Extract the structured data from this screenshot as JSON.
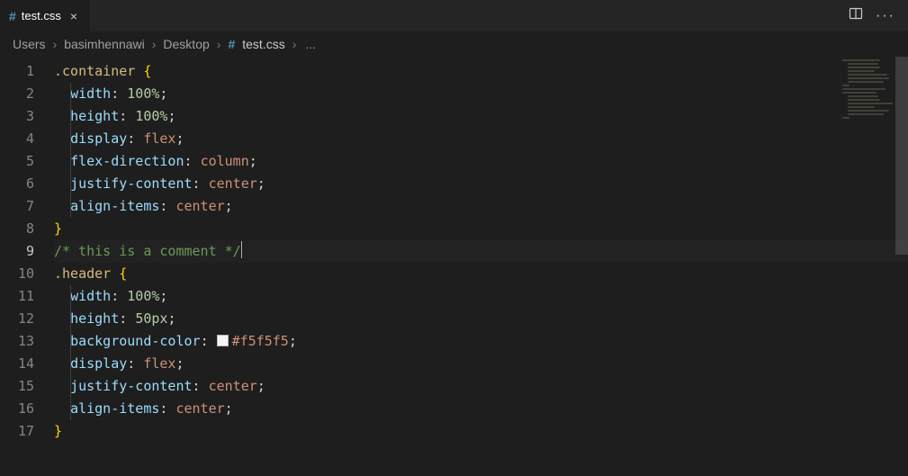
{
  "tab": {
    "icon": "#",
    "label": "test.css",
    "close": "×"
  },
  "title_actions": {
    "more": "···"
  },
  "breadcrumbs": {
    "parts": [
      "Users",
      "basimhennawi",
      "Desktop"
    ],
    "file_icon": "#",
    "filename": "test.css",
    "trailing": "..."
  },
  "active_line": 9,
  "code": {
    "lines": [
      {
        "n": 1,
        "indent": 0,
        "tokens": [
          {
            "t": ".container ",
            "c": "tok-sel"
          },
          {
            "t": "{",
            "c": "tok-brace"
          }
        ]
      },
      {
        "n": 2,
        "indent": 1,
        "tokens": [
          {
            "t": "width",
            "c": "tok-prop"
          },
          {
            "t": ": ",
            "c": "tok-punc"
          },
          {
            "t": "100%",
            "c": "tok-num"
          },
          {
            "t": ";",
            "c": "tok-punc"
          }
        ]
      },
      {
        "n": 3,
        "indent": 1,
        "tokens": [
          {
            "t": "height",
            "c": "tok-prop"
          },
          {
            "t": ": ",
            "c": "tok-punc"
          },
          {
            "t": "100%",
            "c": "tok-num"
          },
          {
            "t": ";",
            "c": "tok-punc"
          }
        ]
      },
      {
        "n": 4,
        "indent": 1,
        "tokens": [
          {
            "t": "display",
            "c": "tok-prop"
          },
          {
            "t": ": ",
            "c": "tok-punc"
          },
          {
            "t": "flex",
            "c": "tok-kw"
          },
          {
            "t": ";",
            "c": "tok-punc"
          }
        ]
      },
      {
        "n": 5,
        "indent": 1,
        "tokens": [
          {
            "t": "flex-direction",
            "c": "tok-prop"
          },
          {
            "t": ": ",
            "c": "tok-punc"
          },
          {
            "t": "column",
            "c": "tok-kw"
          },
          {
            "t": ";",
            "c": "tok-punc"
          }
        ]
      },
      {
        "n": 6,
        "indent": 1,
        "tokens": [
          {
            "t": "justify-content",
            "c": "tok-prop"
          },
          {
            "t": ": ",
            "c": "tok-punc"
          },
          {
            "t": "center",
            "c": "tok-kw"
          },
          {
            "t": ";",
            "c": "tok-punc"
          }
        ]
      },
      {
        "n": 7,
        "indent": 1,
        "tokens": [
          {
            "t": "align-items",
            "c": "tok-prop"
          },
          {
            "t": ": ",
            "c": "tok-punc"
          },
          {
            "t": "center",
            "c": "tok-kw"
          },
          {
            "t": ";",
            "c": "tok-punc"
          }
        ]
      },
      {
        "n": 8,
        "indent": 0,
        "tokens": [
          {
            "t": "}",
            "c": "tok-brace"
          }
        ]
      },
      {
        "n": 9,
        "indent": 0,
        "tokens": [
          {
            "t": "/* this is a comment */",
            "c": "tok-comm"
          }
        ],
        "cursor_after": true
      },
      {
        "n": 10,
        "indent": 0,
        "tokens": [
          {
            "t": ".header ",
            "c": "tok-sel"
          },
          {
            "t": "{",
            "c": "tok-brace"
          }
        ]
      },
      {
        "n": 11,
        "indent": 1,
        "tokens": [
          {
            "t": "width",
            "c": "tok-prop"
          },
          {
            "t": ": ",
            "c": "tok-punc"
          },
          {
            "t": "100%",
            "c": "tok-num"
          },
          {
            "t": ";",
            "c": "tok-punc"
          }
        ]
      },
      {
        "n": 12,
        "indent": 1,
        "tokens": [
          {
            "t": "height",
            "c": "tok-prop"
          },
          {
            "t": ": ",
            "c": "tok-punc"
          },
          {
            "t": "50px",
            "c": "tok-num"
          },
          {
            "t": ";",
            "c": "tok-punc"
          }
        ]
      },
      {
        "n": 13,
        "indent": 1,
        "tokens": [
          {
            "t": "background-color",
            "c": "tok-prop"
          },
          {
            "t": ": ",
            "c": "tok-punc"
          },
          {
            "swatch": "#f5f5f5"
          },
          {
            "t": "#f5f5f5",
            "c": "tok-hex"
          },
          {
            "t": ";",
            "c": "tok-punc"
          }
        ]
      },
      {
        "n": 14,
        "indent": 1,
        "tokens": [
          {
            "t": "display",
            "c": "tok-prop"
          },
          {
            "t": ": ",
            "c": "tok-punc"
          },
          {
            "t": "flex",
            "c": "tok-kw"
          },
          {
            "t": ";",
            "c": "tok-punc"
          }
        ]
      },
      {
        "n": 15,
        "indent": 1,
        "tokens": [
          {
            "t": "justify-content",
            "c": "tok-prop"
          },
          {
            "t": ": ",
            "c": "tok-punc"
          },
          {
            "t": "center",
            "c": "tok-kw"
          },
          {
            "t": ";",
            "c": "tok-punc"
          }
        ]
      },
      {
        "n": 16,
        "indent": 1,
        "tokens": [
          {
            "t": "align-items",
            "c": "tok-prop"
          },
          {
            "t": ": ",
            "c": "tok-punc"
          },
          {
            "t": "center",
            "c": "tok-kw"
          },
          {
            "t": ";",
            "c": "tok-punc"
          }
        ]
      },
      {
        "n": 17,
        "indent": 0,
        "tokens": [
          {
            "t": "}",
            "c": "tok-brace"
          }
        ]
      }
    ]
  }
}
